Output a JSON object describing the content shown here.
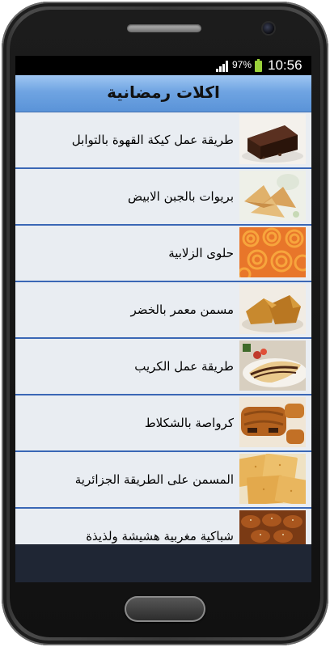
{
  "status_bar": {
    "battery_percent": "97%",
    "time": "10:56",
    "icons": [
      "signal-icon",
      "battery-icon"
    ]
  },
  "app": {
    "title": "اكلات رمضانية"
  },
  "recipes": [
    {
      "label": "طريقة عمل كيكة القهوة بالتوابل",
      "thumb": "coffee-cake-image"
    },
    {
      "label": "بريوات بالجبن الابيض",
      "thumb": "briouats-image"
    },
    {
      "label": "حلوى الزلابية",
      "thumb": "zalabia-image"
    },
    {
      "label": "مسمن معمر بالخضر",
      "thumb": "stuffed-msemen-image"
    },
    {
      "label": "طريقة عمل الكريب",
      "thumb": "crepe-image"
    },
    {
      "label": "كرواصة بالشكلاط",
      "thumb": "chocolate-croissant-image"
    },
    {
      "label": "المسمن على الطريقة الجزائرية",
      "thumb": "algerian-msemen-image"
    },
    {
      "label": "شباكية مغربية هشيشة ولذيذة",
      "thumb": "chebakia-image"
    }
  ],
  "colors": {
    "title_bar_top": "#9fc6f2",
    "title_bar_bottom": "#5a93d8",
    "list_background": "#e9edf2",
    "divider": "#3a67b5"
  }
}
